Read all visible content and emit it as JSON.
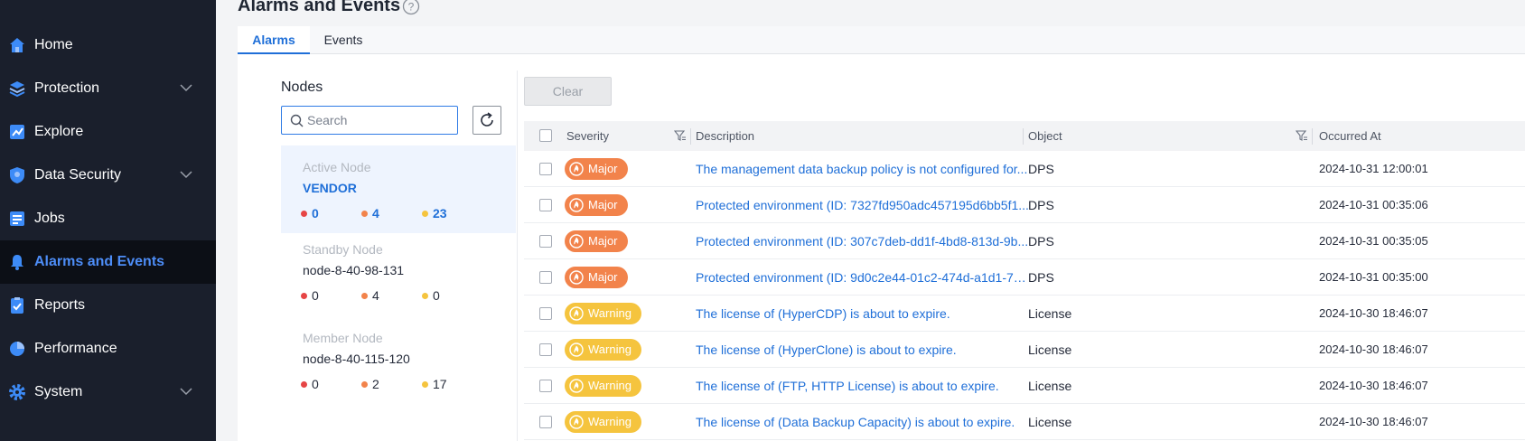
{
  "sidebar": {
    "items": [
      {
        "label": "Home",
        "icon": "home-icon",
        "expandable": false
      },
      {
        "label": "Protection",
        "icon": "protection-icon",
        "expandable": true
      },
      {
        "label": "Explore",
        "icon": "explore-icon",
        "expandable": false
      },
      {
        "label": "Data Security",
        "icon": "data-security-icon",
        "expandable": true
      },
      {
        "label": "Jobs",
        "icon": "jobs-icon",
        "expandable": false
      },
      {
        "label": "Alarms and Events",
        "icon": "bell-icon",
        "expandable": false,
        "active": true
      },
      {
        "label": "Reports",
        "icon": "reports-icon",
        "expandable": false
      },
      {
        "label": "Performance",
        "icon": "performance-icon",
        "expandable": false
      },
      {
        "label": "System",
        "icon": "gear-icon",
        "expandable": true
      }
    ]
  },
  "page": {
    "title": "Alarms and Events",
    "tabs": [
      {
        "label": "Alarms",
        "active": true
      },
      {
        "label": "Events",
        "active": false
      }
    ]
  },
  "nodes": {
    "title": "Nodes",
    "search_placeholder": "Search",
    "cards": [
      {
        "type": "Active Node",
        "name": "VENDOR",
        "critical": "0",
        "major": "4",
        "warning": "23",
        "active": true
      },
      {
        "type": "Standby Node",
        "name": "node-8-40-98-131",
        "critical": "0",
        "major": "4",
        "warning": "0",
        "active": false
      },
      {
        "type": "Member Node",
        "name": "node-8-40-115-120",
        "critical": "0",
        "major": "2",
        "warning": "17",
        "active": false
      }
    ]
  },
  "colors": {
    "critical": "#e64545",
    "major": "#f2834b",
    "warning": "#f5c43e",
    "accent": "#1f6fd8",
    "sidebar_bg": "#1a1f2c"
  },
  "toolbar": {
    "clear_label": "Clear"
  },
  "table": {
    "columns": {
      "severity": "Severity",
      "description": "Description",
      "object": "Object",
      "occurred": "Occurred At"
    },
    "rows": [
      {
        "severity": "Major",
        "level": "major",
        "description": "The management data backup policy is not configured for...",
        "object": "DPS",
        "occurred": "2024-10-31 12:00:01"
      },
      {
        "severity": "Major",
        "level": "major",
        "description": "Protected environment (ID: 7327fd950adc457195d6bb5f1...",
        "object": "DPS",
        "occurred": "2024-10-31 00:35:06"
      },
      {
        "severity": "Major",
        "level": "major",
        "description": "Protected environment (ID: 307c7deb-dd1f-4bd8-813d-9b...",
        "object": "DPS",
        "occurred": "2024-10-31 00:35:05"
      },
      {
        "severity": "Major",
        "level": "major",
        "description": "Protected environment (ID: 9d0c2e44-01c2-474d-a1d1-7d...",
        "object": "DPS",
        "occurred": "2024-10-31 00:35:00"
      },
      {
        "severity": "Warning",
        "level": "warning",
        "description": "The license of (HyperCDP) is about to expire.",
        "object": "License",
        "occurred": "2024-10-30 18:46:07"
      },
      {
        "severity": "Warning",
        "level": "warning",
        "description": "The license of (HyperClone) is about to expire.",
        "object": "License",
        "occurred": "2024-10-30 18:46:07"
      },
      {
        "severity": "Warning",
        "level": "warning",
        "description": "The license of (FTP, HTTP License) is about to expire.",
        "object": "License",
        "occurred": "2024-10-30 18:46:07"
      },
      {
        "severity": "Warning",
        "level": "warning",
        "description": "The license of (Data Backup Capacity) is about to expire.",
        "object": "License",
        "occurred": "2024-10-30 18:46:07"
      }
    ]
  }
}
